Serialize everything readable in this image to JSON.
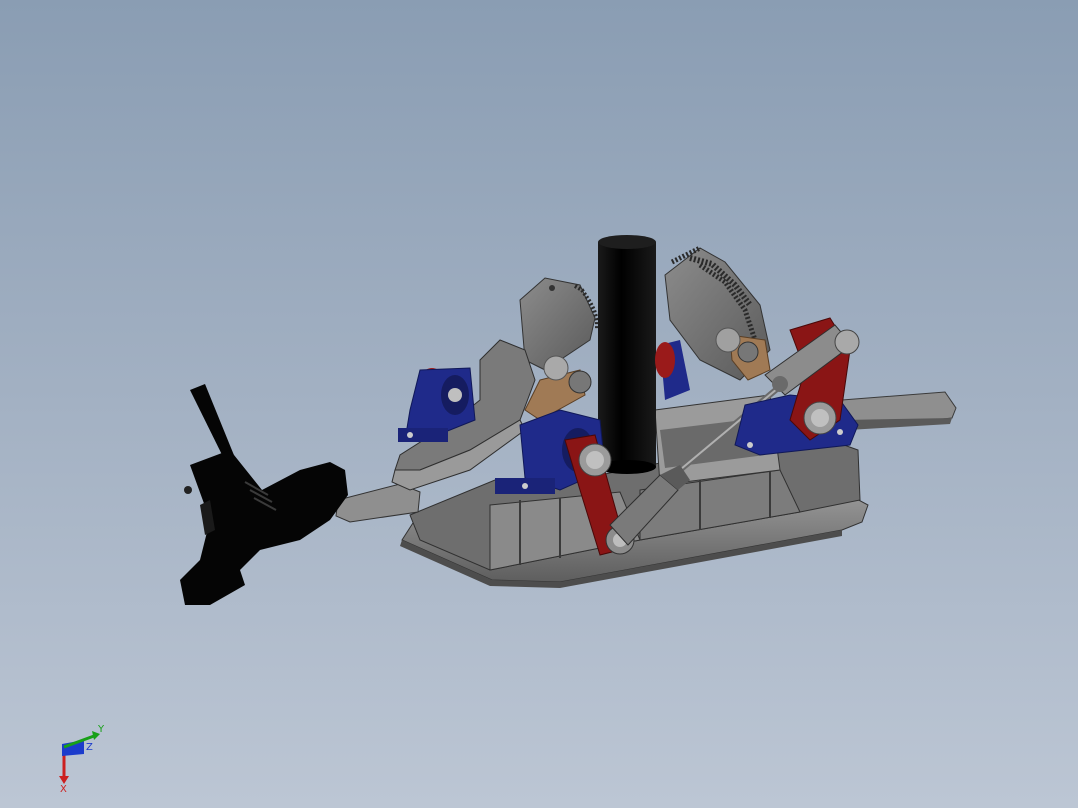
{
  "viewport": {
    "background_top": "#8a9db3",
    "background_bottom": "#bcc6d4"
  },
  "model": {
    "part_colors": {
      "frame": "#7b7b7b",
      "frame_dark": "#4a4a4a",
      "bearing_blue": "#1f2a8a",
      "link_red": "#8a1515",
      "bronze": "#a07a55",
      "column": "#0a0a0a",
      "boot": "#050505"
    }
  },
  "triad": {
    "x_label": "X",
    "y_label": "Y",
    "z_label": "Z",
    "x_color": "#cc2020",
    "y_color": "#18a018",
    "z_color": "#1c3ccc"
  }
}
